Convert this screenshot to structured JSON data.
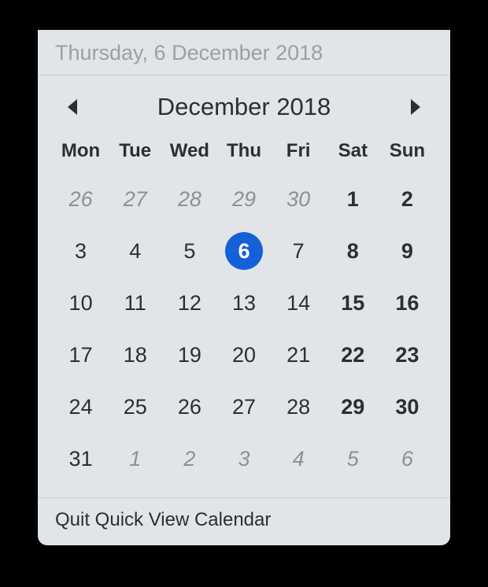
{
  "header": {
    "date_label": "Thursday, 6 December 2018"
  },
  "nav": {
    "month_label": "December 2018",
    "arrow_color": "#2b2f33"
  },
  "weekdays": [
    "Mon",
    "Tue",
    "Wed",
    "Thu",
    "Fri",
    "Sat",
    "Sun"
  ],
  "days": [
    {
      "n": "26",
      "other": true,
      "weekend": false,
      "today": false
    },
    {
      "n": "27",
      "other": true,
      "weekend": false,
      "today": false
    },
    {
      "n": "28",
      "other": true,
      "weekend": false,
      "today": false
    },
    {
      "n": "29",
      "other": true,
      "weekend": false,
      "today": false
    },
    {
      "n": "30",
      "other": true,
      "weekend": false,
      "today": false
    },
    {
      "n": "1",
      "other": false,
      "weekend": true,
      "today": false
    },
    {
      "n": "2",
      "other": false,
      "weekend": true,
      "today": false
    },
    {
      "n": "3",
      "other": false,
      "weekend": false,
      "today": false
    },
    {
      "n": "4",
      "other": false,
      "weekend": false,
      "today": false
    },
    {
      "n": "5",
      "other": false,
      "weekend": false,
      "today": false
    },
    {
      "n": "6",
      "other": false,
      "weekend": false,
      "today": true
    },
    {
      "n": "7",
      "other": false,
      "weekend": false,
      "today": false
    },
    {
      "n": "8",
      "other": false,
      "weekend": true,
      "today": false
    },
    {
      "n": "9",
      "other": false,
      "weekend": true,
      "today": false
    },
    {
      "n": "10",
      "other": false,
      "weekend": false,
      "today": false
    },
    {
      "n": "11",
      "other": false,
      "weekend": false,
      "today": false
    },
    {
      "n": "12",
      "other": false,
      "weekend": false,
      "today": false
    },
    {
      "n": "13",
      "other": false,
      "weekend": false,
      "today": false
    },
    {
      "n": "14",
      "other": false,
      "weekend": false,
      "today": false
    },
    {
      "n": "15",
      "other": false,
      "weekend": true,
      "today": false
    },
    {
      "n": "16",
      "other": false,
      "weekend": true,
      "today": false
    },
    {
      "n": "17",
      "other": false,
      "weekend": false,
      "today": false
    },
    {
      "n": "18",
      "other": false,
      "weekend": false,
      "today": false
    },
    {
      "n": "19",
      "other": false,
      "weekend": false,
      "today": false
    },
    {
      "n": "20",
      "other": false,
      "weekend": false,
      "today": false
    },
    {
      "n": "21",
      "other": false,
      "weekend": false,
      "today": false
    },
    {
      "n": "22",
      "other": false,
      "weekend": true,
      "today": false
    },
    {
      "n": "23",
      "other": false,
      "weekend": true,
      "today": false
    },
    {
      "n": "24",
      "other": false,
      "weekend": false,
      "today": false
    },
    {
      "n": "25",
      "other": false,
      "weekend": false,
      "today": false
    },
    {
      "n": "26",
      "other": false,
      "weekend": false,
      "today": false
    },
    {
      "n": "27",
      "other": false,
      "weekend": false,
      "today": false
    },
    {
      "n": "28",
      "other": false,
      "weekend": false,
      "today": false
    },
    {
      "n": "29",
      "other": false,
      "weekend": true,
      "today": false
    },
    {
      "n": "30",
      "other": false,
      "weekend": true,
      "today": false
    },
    {
      "n": "31",
      "other": false,
      "weekend": false,
      "today": false
    },
    {
      "n": "1",
      "other": true,
      "weekend": false,
      "today": false
    },
    {
      "n": "2",
      "other": true,
      "weekend": false,
      "today": false
    },
    {
      "n": "3",
      "other": true,
      "weekend": false,
      "today": false
    },
    {
      "n": "4",
      "other": true,
      "weekend": false,
      "today": false
    },
    {
      "n": "5",
      "other": true,
      "weekend": true,
      "today": false
    },
    {
      "n": "6",
      "other": true,
      "weekend": true,
      "today": false
    }
  ],
  "footer": {
    "quit_label": "Quit Quick View Calendar"
  },
  "colors": {
    "today_bg": "#1560D8",
    "panel_bg": "#E1E5E8"
  }
}
